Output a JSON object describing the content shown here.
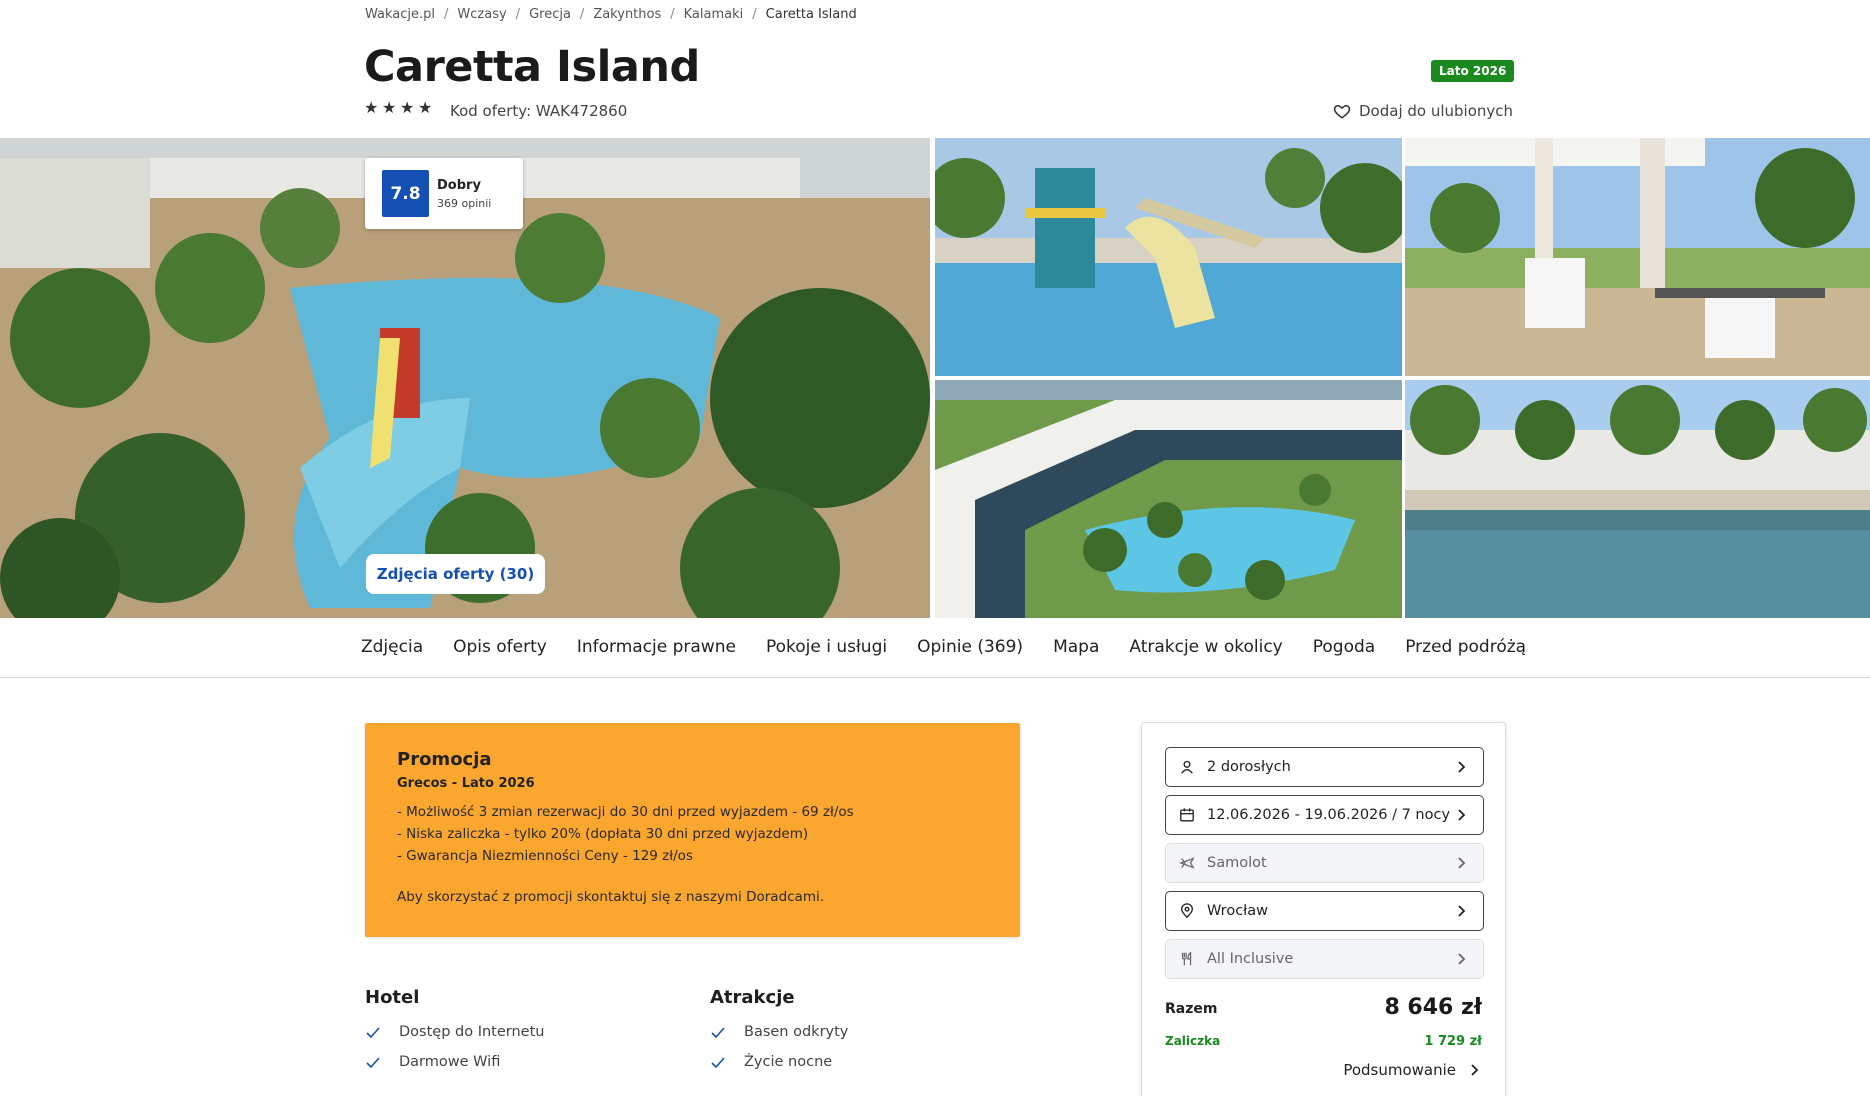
{
  "breadcrumb": [
    "Wakacje.pl",
    "Wczasy",
    "Grecja",
    "Zakynthos",
    "Kalamaki",
    "Caretta Island"
  ],
  "header": {
    "title": "Caretta Island",
    "stars": 4,
    "offer_code": "Kod oferty: WAK472860",
    "season_badge": "Lato 2026",
    "favorite_label": "Dodaj do ulubionych"
  },
  "rating": {
    "score": "7.8",
    "label": "Dobry",
    "count": "369 opinii"
  },
  "gallery": {
    "photos_button": "Zdjęcia oferty (30)"
  },
  "tabs": [
    "Zdjęcia",
    "Opis oferty",
    "Informacje prawne",
    "Pokoje i usługi",
    "Opinie (369)",
    "Mapa",
    "Atrakcje w okolicy",
    "Pogoda",
    "Przed podróżą"
  ],
  "promo": {
    "title": "Promocja",
    "subtitle": "Grecos - Lato 2026",
    "lines": [
      "- Możliwość 3 zmian rezerwacji do 30 dni przed wyjazdem - 69 zł/os",
      "- Niska zaliczka - tylko 20% (dopłata 30 dni przed wyjazdem)",
      "- Gwarancja Niezmienności Ceny - 129 zł/os"
    ],
    "note": "Aby skorzystać z promocji skontaktuj się z naszymi Doradcami."
  },
  "hotel": {
    "title": "Hotel",
    "features": [
      "Dostęp do Internetu",
      "Darmowe Wifi"
    ]
  },
  "attractions": {
    "title": "Atrakcje",
    "features": [
      "Basen odkryty",
      "Życie nocne"
    ]
  },
  "booking": {
    "travelers": "2 dorosłych",
    "dates": "12.06.2026 - 19.06.2026 / 7 nocy",
    "transport": "Samolot",
    "departure": "Wrocław",
    "board": "All Inclusive",
    "total_label": "Razem",
    "total_value": "8 646 zł",
    "deposit_label": "Zaliczka",
    "deposit_value": "1 729 zł",
    "summary_label": "Podsumowanie"
  },
  "colors": {
    "accent_blue": "#1450b4",
    "promo_orange": "#fba62f",
    "badge_green": "#1a8a1e"
  }
}
